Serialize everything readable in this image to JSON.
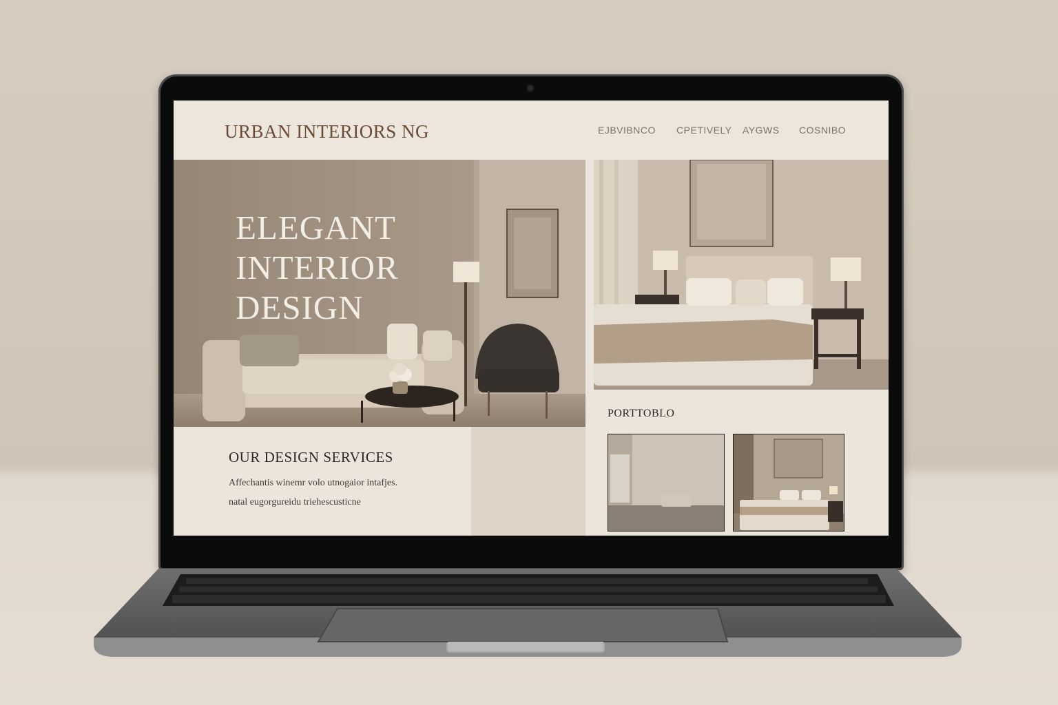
{
  "site": {
    "brand": "URBAN INTERIORS NG",
    "nav": [
      "EJBVIBNCO",
      "CPETIVELY",
      "AYGWS",
      "COSNIBO"
    ]
  },
  "hero": {
    "title_lines": [
      "ELEGANT",
      "INTERIOR",
      "DESIGN"
    ]
  },
  "services": {
    "title": "OUR DESIGN SERVICES",
    "lines": [
      "Affechantis winemr volo utnogaior intafjes.",
      "natal eugorgureidu triehescusticne"
    ]
  },
  "portfolio": {
    "title": "PORTTOBLO"
  },
  "colors": {
    "brand": "#6b4a36",
    "page_bg": "#ebe6dd",
    "laptop_frame": "#0b0b0b"
  }
}
